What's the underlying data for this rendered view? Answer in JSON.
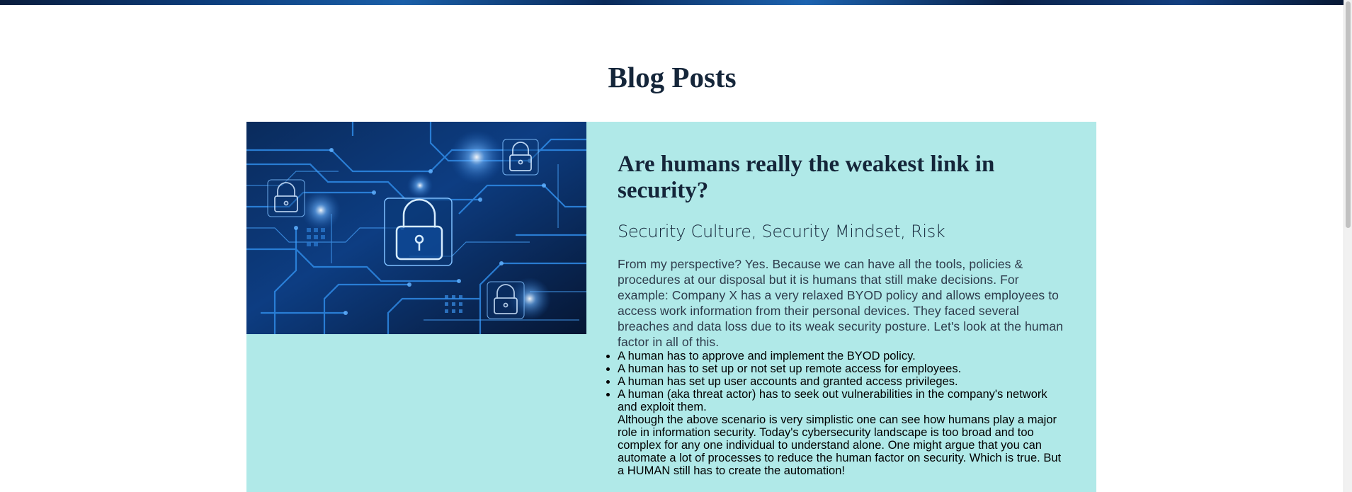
{
  "page": {
    "title": "Blog Posts"
  },
  "post": {
    "image_alt": "circuit-board-padlocks",
    "title": "Are humans really the weakest link in security?",
    "tags": "Security Culture, Security Mindset, Risk",
    "intro": "From my perspective? Yes. Because we can have all the tools, policies & procedures at our disposal but it is humans that still make decisions. For example: Company X has a very relaxed BYOD policy and allows employees to access work information from their personal devices. They faced several breaches and data loss due to its weak security posture. Let's look at the human factor in all of this.",
    "bullets": [
      "A human has to approve and implement the BYOD policy.",
      "A human has to set up or not set up remote access for employees.",
      "A human has set up user accounts and granted access privileges.",
      "A human (aka threat actor) has to seek out vulnerabilities in the company's network and exploit them."
    ],
    "closing": "Although the above scenario is very simplistic one can see how humans play a major role in information security. Today's cybersecurity landscape is too broad and too complex for any one individual to understand alone. One might argue that you can automate a lot of processes to reduce the human factor on security. Which is true. But a HUMAN still has to create the automation!"
  },
  "colors": {
    "card_background": "#b0e9e8",
    "heading": "#15263a",
    "banner": "#0c3c7a"
  }
}
